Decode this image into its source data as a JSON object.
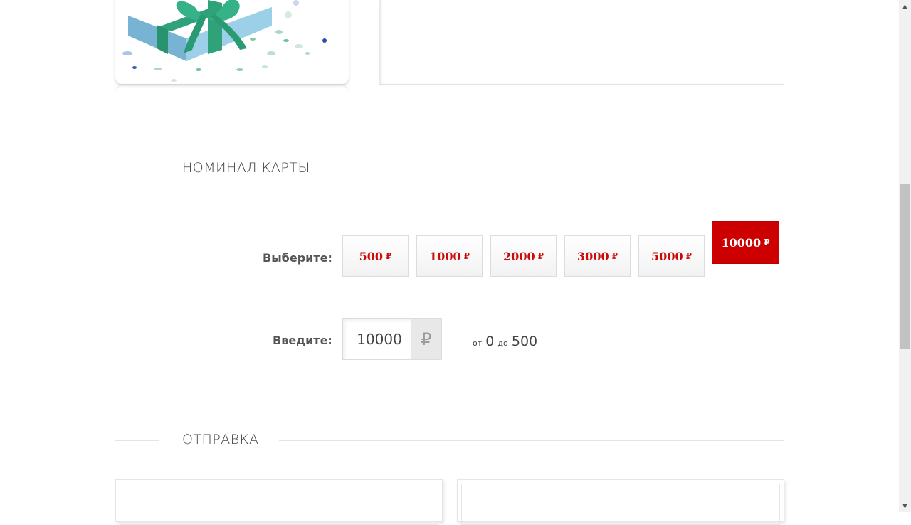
{
  "nominal_section": {
    "title": "НОМИНАЛ КАРТЫ"
  },
  "select_row": {
    "label": "Выберите:",
    "options": [
      {
        "value": "500",
        "currency": "₽"
      },
      {
        "value": "1000",
        "currency": "₽"
      },
      {
        "value": "2000",
        "currency": "₽"
      },
      {
        "value": "3000",
        "currency": "₽"
      },
      {
        "value": "5000",
        "currency": "₽"
      },
      {
        "value": "10000",
        "currency": "₽"
      }
    ],
    "selected": "10000"
  },
  "enter_row": {
    "label": "Введите:",
    "value": "10000",
    "currency": "₽",
    "range_from_label": "от",
    "range_from": "0",
    "range_to_label": "до",
    "range_to": "500"
  },
  "send_section": {
    "title": "ОТПРАВКА"
  },
  "colors": {
    "accent": "#cc0000",
    "text": "#555555",
    "line": "#e4e4e4"
  }
}
